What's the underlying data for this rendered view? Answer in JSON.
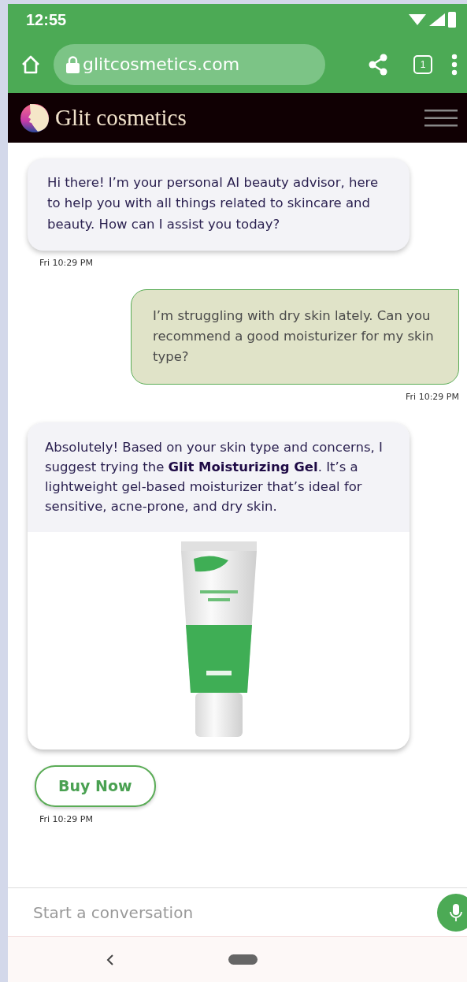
{
  "status_bar": {
    "time": "12:55"
  },
  "browser": {
    "url": "glitcosmetics.com",
    "tab_count": "1"
  },
  "site_header": {
    "brand": "Glit cosmetics"
  },
  "messages": [
    {
      "from_user": false,
      "kind": "text",
      "text": "Hi there! I’m your personal AI beauty advisor, here to help you with all things related to skincare and beauty. How can I assist you today?",
      "time": "Fri 10:29 PM"
    },
    {
      "from_user": true,
      "kind": "text",
      "text": "I’m struggling with dry skin lately. Can you recommend a good moisturizer for my skin type?",
      "time": "Fri 10:29 PM"
    },
    {
      "from_user": false,
      "kind": "product",
      "text": "Absolutely! Based on your skin type and concerns, I suggest trying the **Glit Moisturizing Gel**. It’s a lightweight gel-based moisturizer that’s ideal for sensitive, acne-prone, and dry skin.",
      "button": "Buy Now",
      "time": "Fri 10:29 PM"
    }
  ],
  "composer": {
    "placeholder": "Start a conversation"
  }
}
